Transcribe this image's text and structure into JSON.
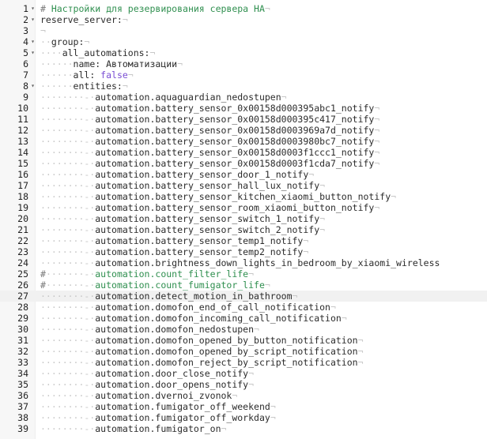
{
  "editor": {
    "active_line": 27,
    "lines": [
      {
        "n": "1",
        "fold": "▾",
        "segs": [
          [
            "hsh",
            "# "
          ],
          [
            "cm",
            "Настройки для резервирования сервера HA"
          ],
          [
            "ws",
            "¬"
          ]
        ]
      },
      {
        "n": "2",
        "fold": "▾",
        "segs": [
          [
            "k",
            "reserve_server:"
          ],
          [
            "ws",
            "¬"
          ]
        ]
      },
      {
        "n": "3",
        "fold": "",
        "segs": [
          [
            "ws",
            "¬"
          ]
        ]
      },
      {
        "n": "4",
        "fold": "▾",
        "segs": [
          [
            "ws",
            "··"
          ],
          [
            "k",
            "group:"
          ],
          [
            "ws",
            "¬"
          ]
        ]
      },
      {
        "n": "5",
        "fold": "▾",
        "segs": [
          [
            "ws",
            "····"
          ],
          [
            "k",
            "all_automations:"
          ],
          [
            "ws",
            "¬"
          ]
        ]
      },
      {
        "n": "6",
        "fold": "",
        "segs": [
          [
            "ws",
            "······"
          ],
          [
            "k",
            "name: Автоматизации"
          ],
          [
            "ws",
            "¬"
          ]
        ]
      },
      {
        "n": "7",
        "fold": "",
        "segs": [
          [
            "ws",
            "······"
          ],
          [
            "k",
            "all: "
          ],
          [
            "bool",
            "false"
          ],
          [
            "ws",
            "¬"
          ]
        ]
      },
      {
        "n": "8",
        "fold": "▾",
        "segs": [
          [
            "ws",
            "······"
          ],
          [
            "k",
            "entities:"
          ],
          [
            "ws",
            "¬"
          ]
        ]
      },
      {
        "n": "9",
        "fold": "",
        "segs": [
          [
            "ws",
            "········-·"
          ],
          [
            "k",
            "automation.aquaguardian_nedostupen"
          ],
          [
            "ws",
            "¬"
          ]
        ]
      },
      {
        "n": "10",
        "fold": "",
        "segs": [
          [
            "ws",
            "········-·"
          ],
          [
            "k",
            "automation.battery_sensor_0x00158d000395abc1_notify"
          ],
          [
            "ws",
            "¬"
          ]
        ]
      },
      {
        "n": "11",
        "fold": "",
        "segs": [
          [
            "ws",
            "········-·"
          ],
          [
            "k",
            "automation.battery_sensor_0x00158d000395c417_notify"
          ],
          [
            "ws",
            "¬"
          ]
        ]
      },
      {
        "n": "12",
        "fold": "",
        "segs": [
          [
            "ws",
            "········-·"
          ],
          [
            "k",
            "automation.battery_sensor_0x00158d0003969a7d_notify"
          ],
          [
            "ws",
            "¬"
          ]
        ]
      },
      {
        "n": "13",
        "fold": "",
        "segs": [
          [
            "ws",
            "········-·"
          ],
          [
            "k",
            "automation.battery_sensor_0x00158d0003980bc7_notify"
          ],
          [
            "ws",
            "¬"
          ]
        ]
      },
      {
        "n": "14",
        "fold": "",
        "segs": [
          [
            "ws",
            "········-·"
          ],
          [
            "k",
            "automation.battery_sensor_0x00158d0003f1ccc1_notify"
          ],
          [
            "ws",
            "¬"
          ]
        ]
      },
      {
        "n": "15",
        "fold": "",
        "segs": [
          [
            "ws",
            "········-·"
          ],
          [
            "k",
            "automation.battery_sensor_0x00158d0003f1cda7_notify"
          ],
          [
            "ws",
            "¬"
          ]
        ]
      },
      {
        "n": "16",
        "fold": "",
        "segs": [
          [
            "ws",
            "········-·"
          ],
          [
            "k",
            "automation.battery_sensor_door_1_notify"
          ],
          [
            "ws",
            "¬"
          ]
        ]
      },
      {
        "n": "17",
        "fold": "",
        "segs": [
          [
            "ws",
            "········-·"
          ],
          [
            "k",
            "automation.battery_sensor_hall_lux_notify"
          ],
          [
            "ws",
            "¬"
          ]
        ]
      },
      {
        "n": "18",
        "fold": "",
        "segs": [
          [
            "ws",
            "········-·"
          ],
          [
            "k",
            "automation.battery_sensor_kitchen_xiaomi_button_notify"
          ],
          [
            "ws",
            "¬"
          ]
        ]
      },
      {
        "n": "19",
        "fold": "",
        "segs": [
          [
            "ws",
            "········-·"
          ],
          [
            "k",
            "automation.battery_sensor_room_xiaomi_button_notify"
          ],
          [
            "ws",
            "¬"
          ]
        ]
      },
      {
        "n": "20",
        "fold": "",
        "segs": [
          [
            "ws",
            "········-·"
          ],
          [
            "k",
            "automation.battery_sensor_switch_1_notify"
          ],
          [
            "ws",
            "¬"
          ]
        ]
      },
      {
        "n": "21",
        "fold": "",
        "segs": [
          [
            "ws",
            "········-·"
          ],
          [
            "k",
            "automation.battery_sensor_switch_2_notify"
          ],
          [
            "ws",
            "¬"
          ]
        ]
      },
      {
        "n": "22",
        "fold": "",
        "segs": [
          [
            "ws",
            "········-·"
          ],
          [
            "k",
            "automation.battery_sensor_temp1_notify"
          ],
          [
            "ws",
            "¬"
          ]
        ]
      },
      {
        "n": "23",
        "fold": "",
        "segs": [
          [
            "ws",
            "········-·"
          ],
          [
            "k",
            "automation.battery_sensor_temp2_notify"
          ],
          [
            "ws",
            "¬"
          ]
        ]
      },
      {
        "n": "24",
        "fold": "",
        "segs": [
          [
            "ws",
            "········-·"
          ],
          [
            "k",
            "automation.brightness_down_lights_in_bedroom_by_xiaomi_wireless"
          ]
        ]
      },
      {
        "n": "25",
        "fold": "",
        "segs": [
          [
            "hsh",
            "#"
          ],
          [
            "ws",
            "·······-·"
          ],
          [
            "cm",
            "automation.count_filter_life"
          ],
          [
            "ws",
            "¬"
          ]
        ]
      },
      {
        "n": "26",
        "fold": "",
        "segs": [
          [
            "hsh",
            "#"
          ],
          [
            "ws",
            "·······-·"
          ],
          [
            "cm",
            "automation.count_fumigator_life"
          ],
          [
            "ws",
            "¬"
          ]
        ]
      },
      {
        "n": "27",
        "fold": "",
        "segs": [
          [
            "ws",
            "········-·"
          ],
          [
            "k",
            "automation.detect_motion_in_bathroom"
          ],
          [
            "ws",
            "¬"
          ]
        ]
      },
      {
        "n": "28",
        "fold": "",
        "segs": [
          [
            "ws",
            "········-·"
          ],
          [
            "k",
            "automation.domofon_end_of_call_notification"
          ],
          [
            "ws",
            "¬"
          ]
        ]
      },
      {
        "n": "29",
        "fold": "",
        "segs": [
          [
            "ws",
            "········-·"
          ],
          [
            "k",
            "automation.domofon_incoming_call_notification"
          ],
          [
            "ws",
            "¬"
          ]
        ]
      },
      {
        "n": "30",
        "fold": "",
        "segs": [
          [
            "ws",
            "········-·"
          ],
          [
            "k",
            "automation.domofon_nedostupen"
          ],
          [
            "ws",
            "¬"
          ]
        ]
      },
      {
        "n": "31",
        "fold": "",
        "segs": [
          [
            "ws",
            "········-·"
          ],
          [
            "k",
            "automation.domofon_opened_by_button_notification"
          ],
          [
            "ws",
            "¬"
          ]
        ]
      },
      {
        "n": "32",
        "fold": "",
        "segs": [
          [
            "ws",
            "········-·"
          ],
          [
            "k",
            "automation.domofon_opened_by_script_notification"
          ],
          [
            "ws",
            "¬"
          ]
        ]
      },
      {
        "n": "33",
        "fold": "",
        "segs": [
          [
            "ws",
            "········-·"
          ],
          [
            "k",
            "automation.domofon_reject_by_script_notification"
          ],
          [
            "ws",
            "¬"
          ]
        ]
      },
      {
        "n": "34",
        "fold": "",
        "segs": [
          [
            "ws",
            "········-·"
          ],
          [
            "k",
            "automation.door_close_notify"
          ],
          [
            "ws",
            "¬"
          ]
        ]
      },
      {
        "n": "35",
        "fold": "",
        "segs": [
          [
            "ws",
            "········-·"
          ],
          [
            "k",
            "automation.door_opens_notify"
          ],
          [
            "ws",
            "¬"
          ]
        ]
      },
      {
        "n": "36",
        "fold": "",
        "segs": [
          [
            "ws",
            "········-·"
          ],
          [
            "k",
            "automation.dvernoi_zvonok"
          ],
          [
            "ws",
            "¬"
          ]
        ]
      },
      {
        "n": "37",
        "fold": "",
        "segs": [
          [
            "ws",
            "········-·"
          ],
          [
            "k",
            "automation.fumigator_off_weekend"
          ],
          [
            "ws",
            "¬"
          ]
        ]
      },
      {
        "n": "38",
        "fold": "",
        "segs": [
          [
            "ws",
            "········-·"
          ],
          [
            "k",
            "automation.fumigator_off_workday"
          ],
          [
            "ws",
            "¬"
          ]
        ]
      },
      {
        "n": "39",
        "fold": "",
        "segs": [
          [
            "ws",
            "········-·"
          ],
          [
            "k",
            "automation.fumigator_on"
          ],
          [
            "ws",
            "¬"
          ]
        ]
      }
    ]
  }
}
